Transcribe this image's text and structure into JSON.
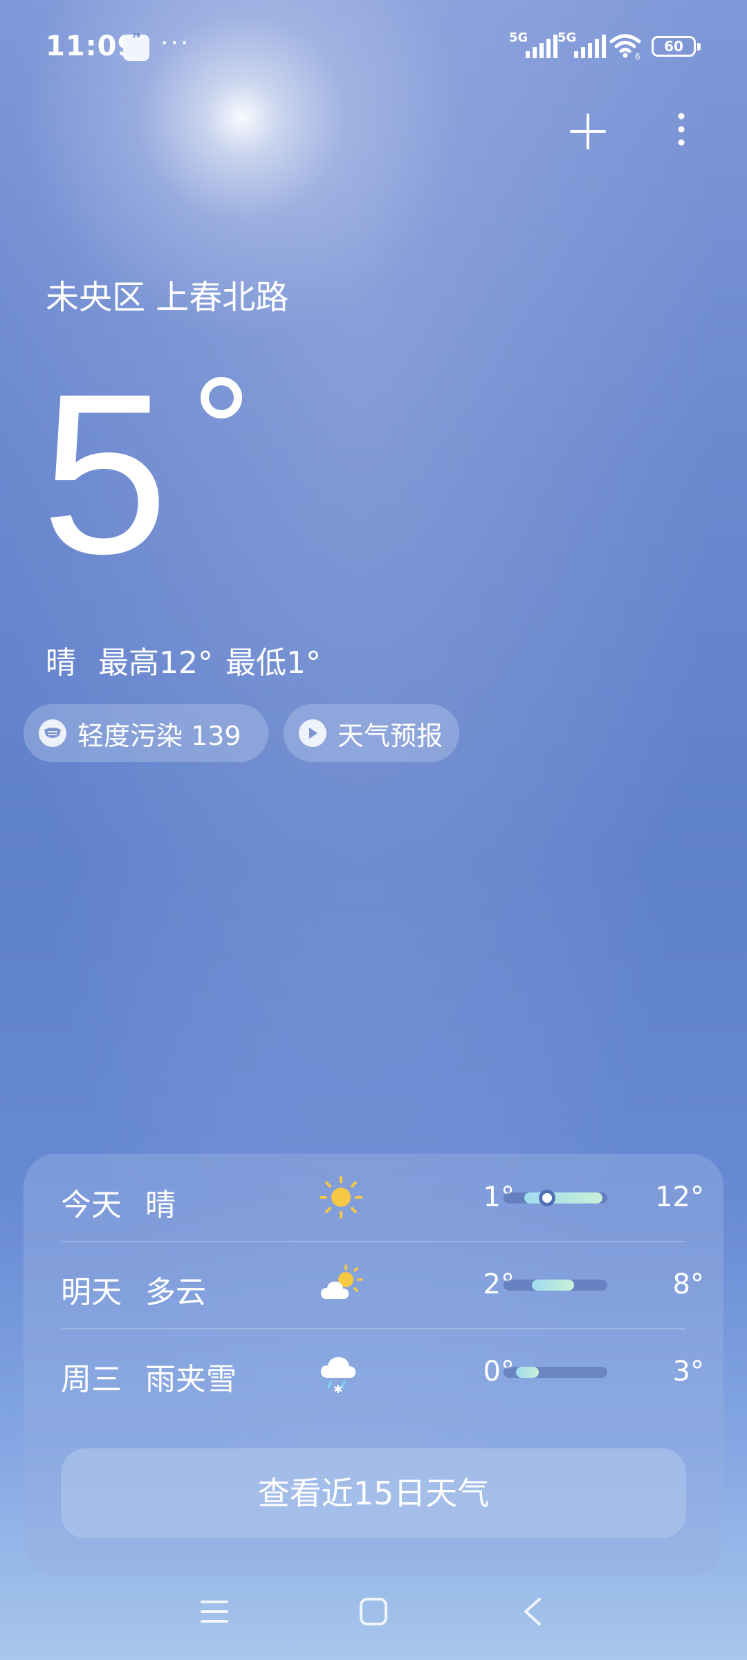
{
  "status_bar": {
    "time": "11:09",
    "calendar_badge": "29",
    "overflow": "···",
    "sim1": "5G",
    "sim2": "5G",
    "wifi_sub": "6",
    "battery": "60"
  },
  "location": "未央区 上春北路",
  "current": {
    "temperature": "5",
    "condition": "晴",
    "high": "最高12°",
    "low": "最低1°"
  },
  "chips": {
    "air_quality": "轻度污染 139",
    "forecast_video": "天气预报"
  },
  "forecast": [
    {
      "day": "今天",
      "condition": "晴",
      "icon": "sun-icon",
      "low": "1°",
      "high": "12°",
      "range_start": 0.2,
      "range_end": 0.95,
      "current": 0.42
    },
    {
      "day": "明天",
      "condition": "多云",
      "icon": "partly-cloudy-icon",
      "low": "2°",
      "high": "8°",
      "range_start": 0.27,
      "range_end": 0.68
    },
    {
      "day": "周三",
      "condition": "雨夹雪",
      "icon": "sleet-icon",
      "low": "0°",
      "high": "3°",
      "range_start": 0.12,
      "range_end": 0.34
    }
  ],
  "cta_label": "查看近15日天气",
  "colors": {
    "sky_top": "#7f98d8",
    "sky_bottom": "#a8c7ec",
    "range_fill": "#9fdcee"
  }
}
